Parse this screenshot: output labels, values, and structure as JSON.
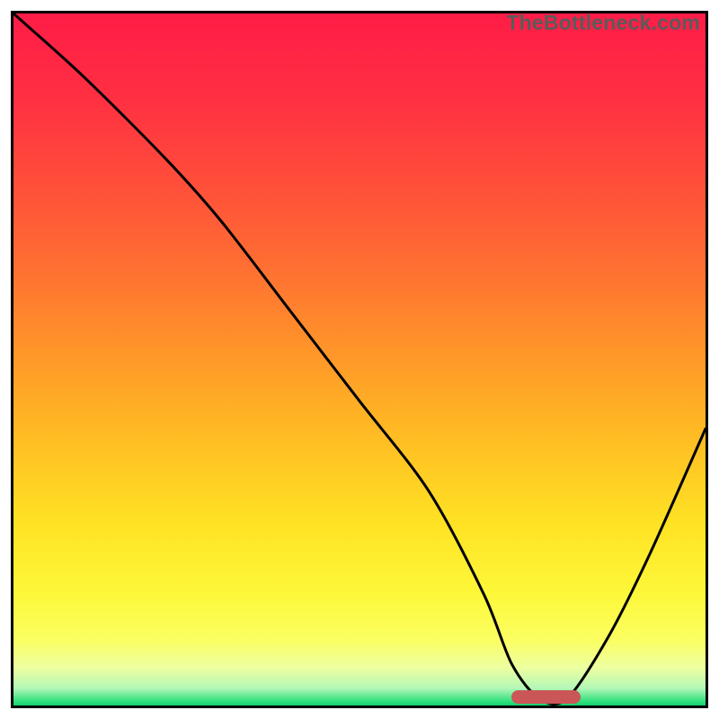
{
  "watermark": "TheBottleneck.com",
  "chart_data": {
    "type": "line",
    "title": "",
    "xlabel": "",
    "ylabel": "",
    "xlim": [
      0,
      100
    ],
    "ylim": [
      0,
      100
    ],
    "grid": false,
    "legend": false,
    "x": [
      0,
      10,
      22,
      30,
      40,
      50,
      60,
      68,
      72,
      76,
      80,
      86,
      92,
      100
    ],
    "values": [
      100,
      91,
      79,
      70,
      57,
      44,
      31,
      16,
      6,
      1,
      1,
      10,
      22,
      40
    ],
    "notch_x_range": [
      72,
      82
    ],
    "gradient_stops": [
      {
        "offset": 0.0,
        "color": "#ff1c47"
      },
      {
        "offset": 0.12,
        "color": "#ff2f42"
      },
      {
        "offset": 0.25,
        "color": "#ff4f3a"
      },
      {
        "offset": 0.38,
        "color": "#ff7331"
      },
      {
        "offset": 0.5,
        "color": "#ff9928"
      },
      {
        "offset": 0.62,
        "color": "#ffbf23"
      },
      {
        "offset": 0.74,
        "color": "#ffe324"
      },
      {
        "offset": 0.84,
        "color": "#fdf83a"
      },
      {
        "offset": 0.905,
        "color": "#fbff62"
      },
      {
        "offset": 0.945,
        "color": "#eeffa0"
      },
      {
        "offset": 0.975,
        "color": "#b3f7b6"
      },
      {
        "offset": 0.995,
        "color": "#28e07a"
      },
      {
        "offset": 1.0,
        "color": "#17cf70"
      }
    ],
    "curve_color": "#000000",
    "curve_width": 3,
    "marker_color": "#cb5658"
  }
}
